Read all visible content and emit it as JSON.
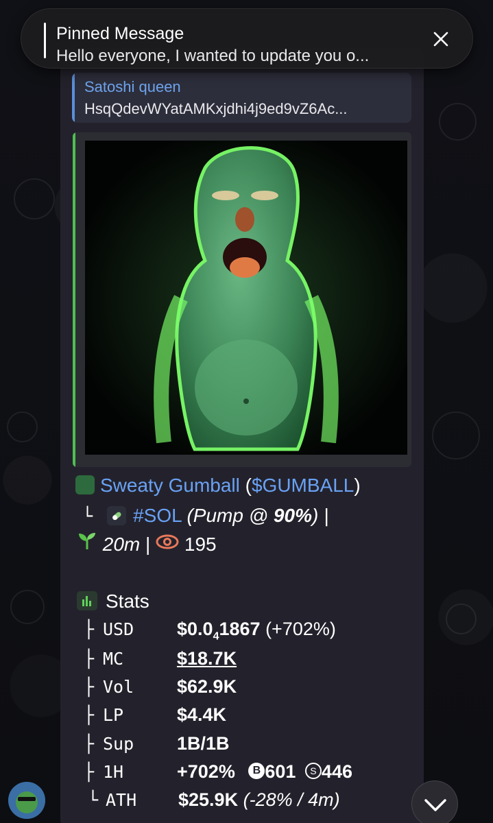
{
  "pinned": {
    "title": "Pinned Message",
    "preview": "Hello everyone, I wanted to update you o..."
  },
  "reply": {
    "name": "Satoshi queen",
    "text": "HsqQdevWYatAMKxjdhi4j9ed9vZ6Ac..."
  },
  "token": {
    "name": "Sweaty Gumball",
    "ticker": "$GUMBALL",
    "chain_tag": "#SOL",
    "pump_label": "Pump @",
    "pump_value": "90%",
    "age": "20m",
    "views": "195"
  },
  "stats": {
    "title": "Stats",
    "rows": [
      {
        "prefix": "├",
        "key": "USD",
        "value": "$0.0",
        "sub": "4",
        "value2": "1867",
        "extra": "(+702%)"
      },
      {
        "prefix": "├",
        "key": "MC",
        "value": "$18.7K"
      },
      {
        "prefix": "├",
        "key": "Vol",
        "value": "$62.9K"
      },
      {
        "prefix": "├",
        "key": "LP",
        "value": "$4.4K"
      },
      {
        "prefix": "├",
        "key": "Sup",
        "value": "1B/1B"
      },
      {
        "prefix": "├",
        "key": "1H",
        "value": "+702%",
        "buys": "601",
        "sells": "446"
      },
      {
        "prefix": "└",
        "key": "ATH",
        "value": "$25.9K",
        "extra": "(-28% / 4m)"
      }
    ]
  },
  "colors": {
    "bubble": "#23222c",
    "link": "#6aa2f5",
    "accent_green": "#4fbf52",
    "reply_accent": "#5b8fd8"
  }
}
